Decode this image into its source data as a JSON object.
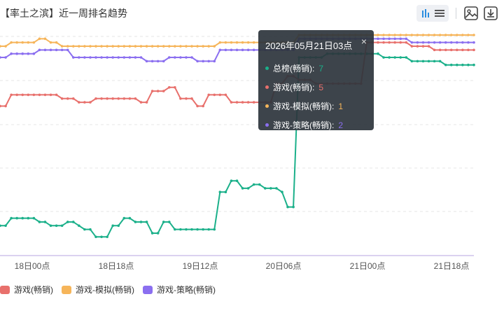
{
  "title": "【率土之滨】近一周排名趋势",
  "toolbar": {
    "chart_icon": "bar-chart-icon",
    "table_icon": "table-icon",
    "image_icon": "save-image-icon",
    "download_icon": "download-icon"
  },
  "tooltip": {
    "title": "2026年05月21日03点",
    "close": "×",
    "rows": [
      {
        "label": "总榜(畅销):",
        "value": "7"
      },
      {
        "label": "游戏(畅销):",
        "value": "5"
      },
      {
        "label": "游戏-模拟(畅销):",
        "value": "1"
      },
      {
        "label": "游戏-策略(畅销):",
        "value": "2"
      }
    ]
  },
  "legend": [
    {
      "label": "游戏(畅销)"
    },
    {
      "label": "游戏-模拟(畅销)"
    },
    {
      "label": "游戏-策略(畅销)"
    }
  ],
  "colors": {
    "overall": "#1bb08a",
    "game": "#e8706c",
    "simulation": "#f6b55a",
    "strategy": "#8b6ff0",
    "grid": "#e6e6e6",
    "axis": "#c5b7e8"
  },
  "chart_data": {
    "type": "line",
    "x_tick_labels": [
      "18日00点",
      "18日18点",
      "19日12点",
      "20日06点",
      "21日00点",
      "21日18点"
    ],
    "y_inverted": true,
    "series": [
      {
        "name": "总榜(畅销)",
        "key": "overall",
        "values": [
          52,
          52,
          50,
          50,
          50,
          50,
          50,
          51,
          51,
          52,
          52,
          52,
          51,
          51,
          52,
          53,
          53,
          55,
          55,
          55,
          52,
          52,
          50,
          50,
          51,
          51,
          51,
          54,
          54,
          51,
          51,
          53,
          53,
          53,
          53,
          53,
          53,
          53,
          53,
          43,
          43,
          40,
          40,
          42,
          42,
          41,
          41,
          42,
          42,
          42,
          43,
          47,
          47,
          7,
          7,
          7,
          7,
          7,
          6,
          6,
          6,
          6,
          6,
          6,
          6,
          6,
          6,
          6,
          7,
          7,
          7,
          7,
          7,
          8,
          8,
          8,
          8,
          8,
          8,
          9,
          9,
          9,
          9,
          9,
          9
        ]
      },
      {
        "name": "游戏(畅销)",
        "key": "game",
        "values": [
          20,
          20,
          17,
          17,
          17,
          17,
          17,
          17,
          17,
          17,
          17,
          18,
          18,
          18,
          19,
          19,
          19,
          18,
          18,
          18,
          18,
          18,
          18,
          18,
          18,
          19,
          19,
          16,
          16,
          16,
          15,
          15,
          18,
          18,
          18,
          20,
          20,
          17,
          17,
          17,
          17,
          19,
          19,
          19,
          19,
          19,
          19,
          19,
          19,
          14,
          14,
          12,
          12,
          13,
          13,
          13,
          14,
          14,
          14,
          14,
          14,
          14,
          14,
          14,
          14,
          3,
          3,
          3,
          3,
          3,
          3,
          3,
          3,
          4,
          4,
          4,
          4,
          5,
          5,
          5,
          5,
          5,
          5,
          5,
          5
        ]
      },
      {
        "name": "游戏-模拟(畅销)",
        "key": "simulation",
        "values": [
          4,
          4,
          3,
          3,
          3,
          3,
          3,
          2,
          2,
          3,
          3,
          4,
          4,
          4,
          4,
          4,
          4,
          4,
          4,
          4,
          4,
          4,
          4,
          4,
          4,
          4,
          4,
          4,
          4,
          4,
          4,
          4,
          4,
          4,
          4,
          4,
          4,
          4,
          4,
          3,
          3,
          3,
          3,
          3,
          3,
          3,
          3,
          3,
          3,
          3,
          3,
          3,
          3,
          1,
          1,
          1,
          1,
          1,
          1,
          1,
          1,
          1,
          1,
          1,
          1,
          1,
          1,
          1,
          1,
          1,
          1,
          1,
          1,
          1,
          1,
          1,
          1,
          1,
          1,
          1,
          1,
          1,
          1,
          1,
          1
        ]
      },
      {
        "name": "游戏-策略(畅销)",
        "key": "strategy",
        "values": [
          7,
          7,
          6,
          6,
          6,
          6,
          6,
          5,
          5,
          5,
          5,
          5,
          5,
          7,
          7,
          7,
          7,
          7,
          7,
          7,
          7,
          7,
          7,
          7,
          7,
          7,
          8,
          8,
          8,
          8,
          7,
          7,
          7,
          7,
          7,
          8,
          8,
          8,
          8,
          5,
          5,
          5,
          5,
          5,
          5,
          5,
          5,
          5,
          5,
          5,
          5,
          5,
          5,
          2,
          2,
          2,
          2,
          2,
          2,
          2,
          2,
          2,
          2,
          2,
          2,
          2,
          2,
          2,
          2,
          2,
          2,
          2,
          2,
          3,
          3,
          3,
          3,
          3,
          3,
          3,
          3,
          3,
          3,
          3,
          3
        ]
      }
    ],
    "grid": true,
    "legend_position": "bottom-left"
  }
}
